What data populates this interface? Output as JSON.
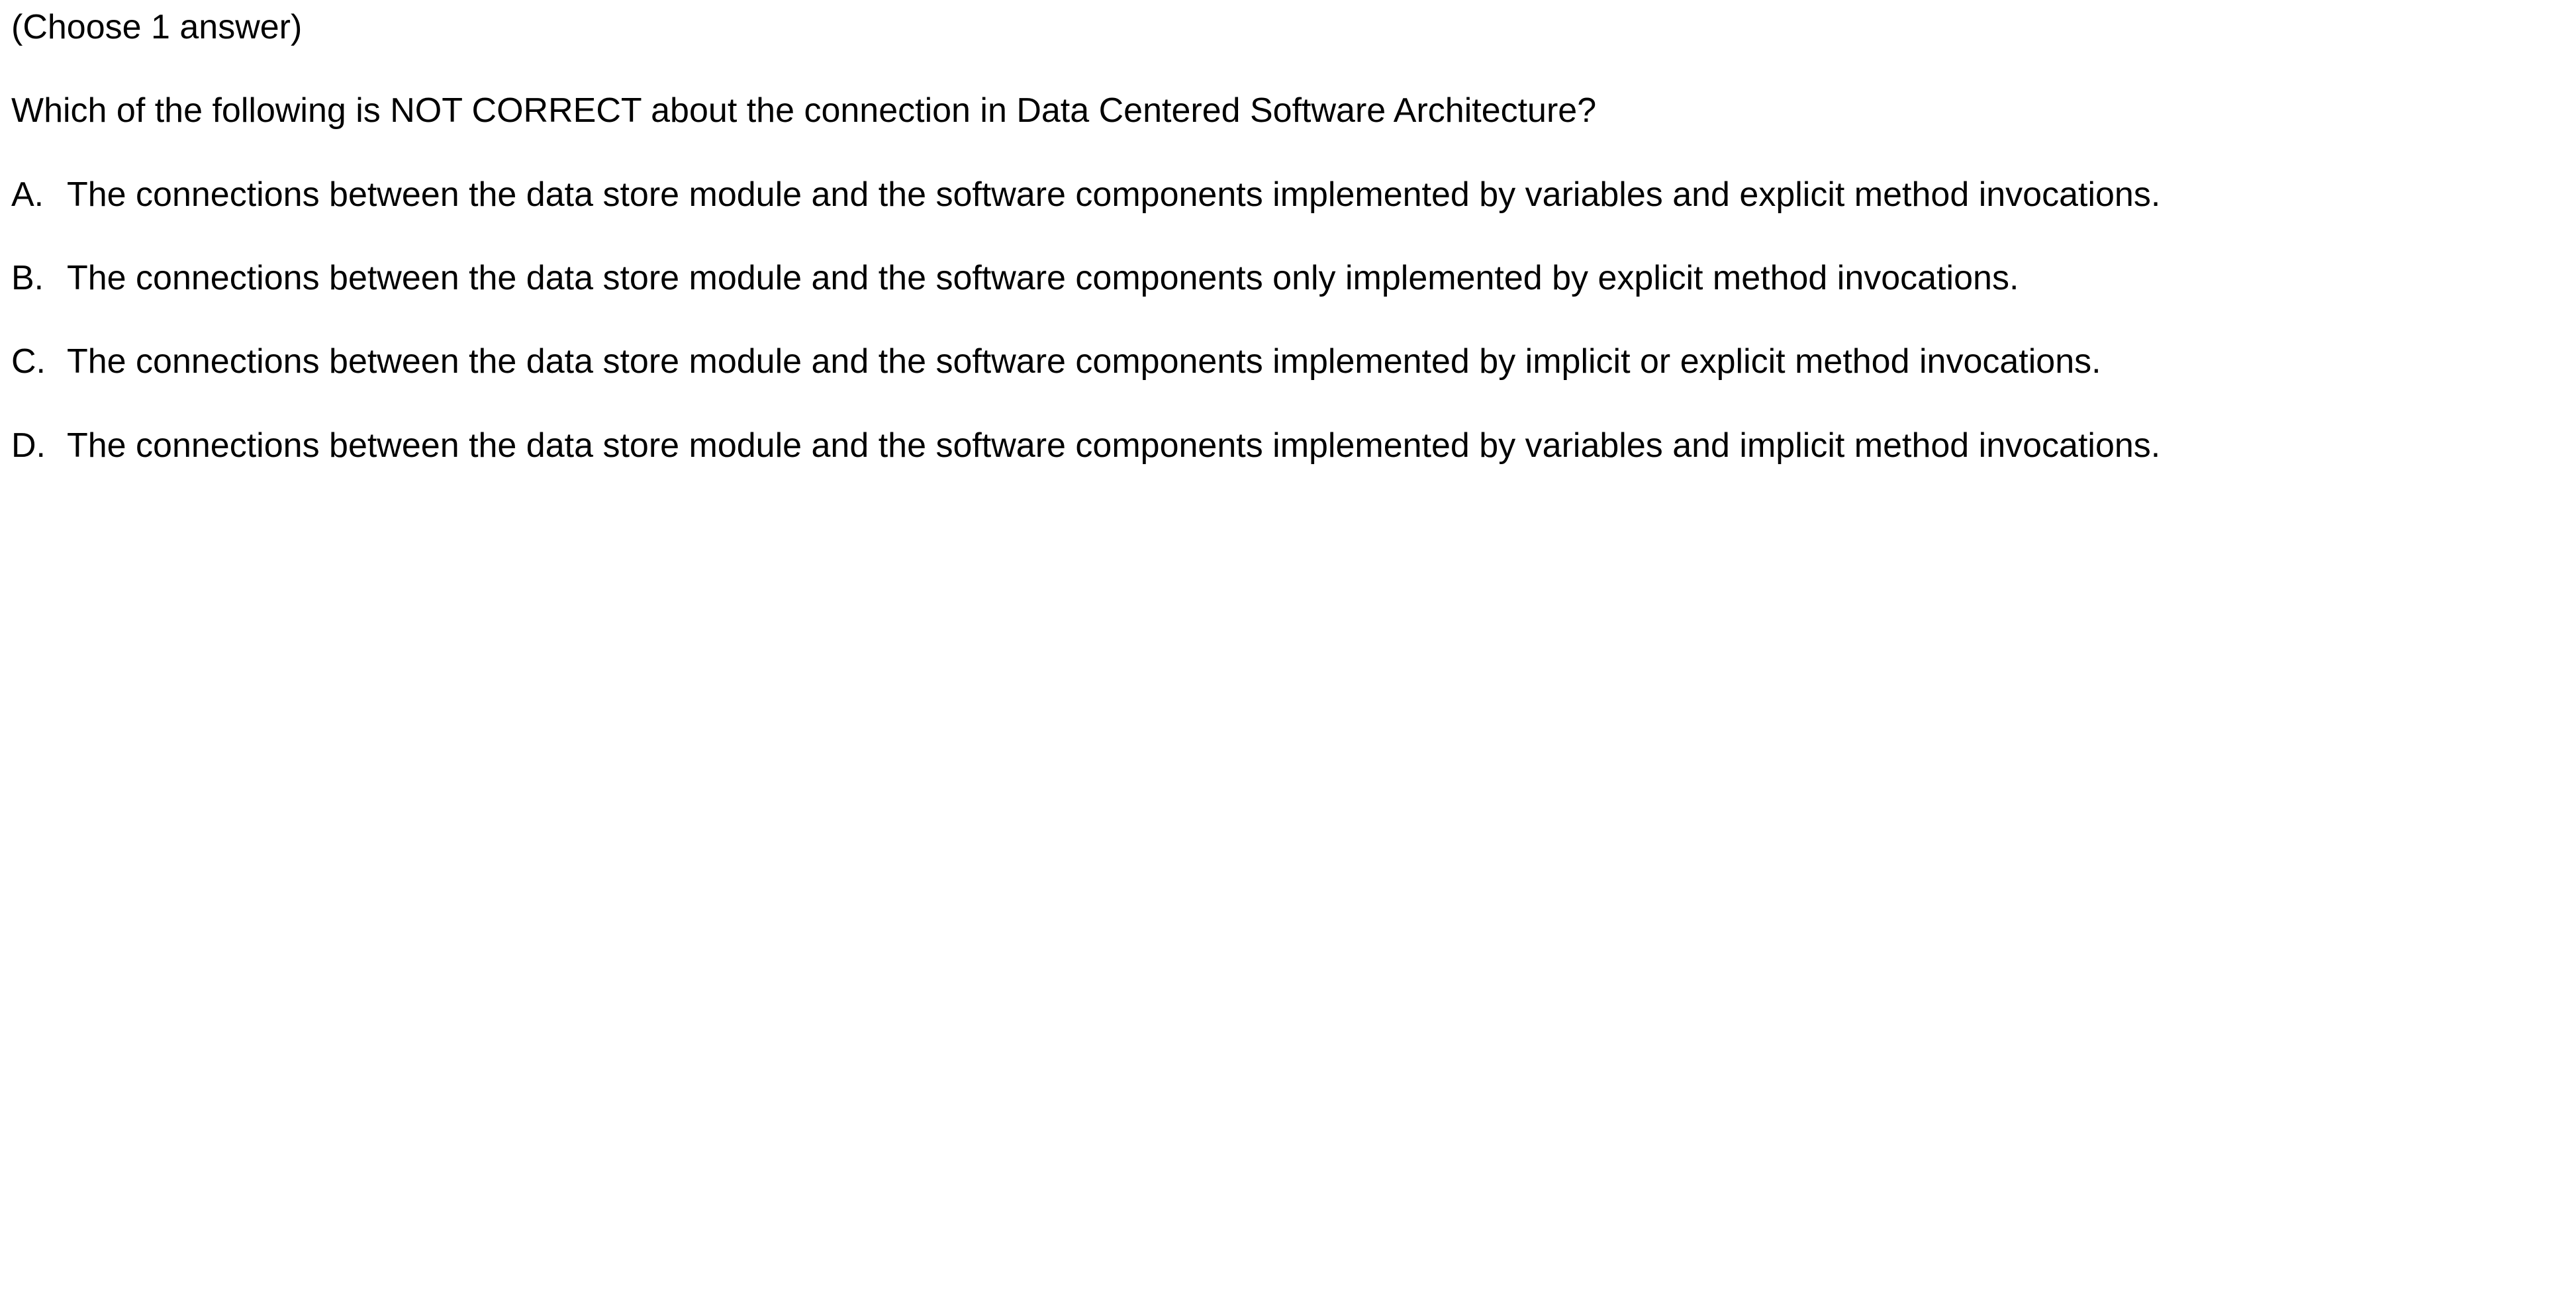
{
  "instruction": "(Choose 1 answer)",
  "question": "Which of the following is NOT CORRECT about the connection in Data Centered Software Architecture?",
  "options": [
    {
      "letter": "A.",
      "text": "The connections between the data store module and the software components implemented by variables and explicit method invocations."
    },
    {
      "letter": "B.",
      "text": "The connections between the data store module and the software components only implemented by explicit method invocations."
    },
    {
      "letter": "C.",
      "text": "The connections between the data store module and the software components implemented by implicit or explicit method invocations."
    },
    {
      "letter": "D.",
      "text": "The connections between the data store module and the software components implemented by variables and implicit method invocations."
    }
  ]
}
